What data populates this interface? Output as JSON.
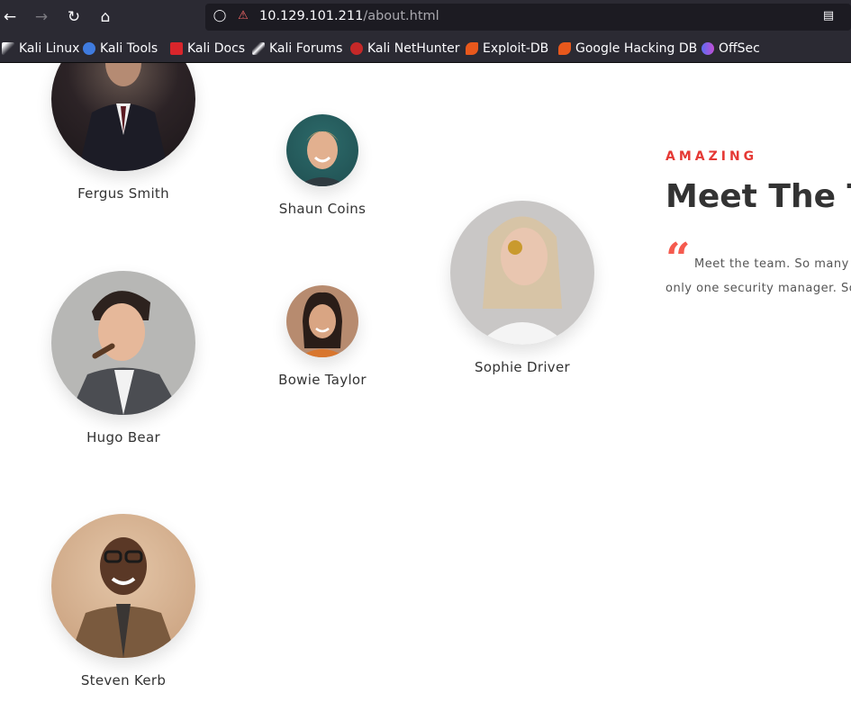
{
  "browser": {
    "url_host": "10.129.101.211",
    "url_path": "/about.html",
    "bookmarks": [
      {
        "label": "Kali Linux",
        "icon": "kali-dragon-icon"
      },
      {
        "label": "Kali Tools",
        "icon": "kali-tools-icon"
      },
      {
        "label": "Kali Docs",
        "icon": "kali-docs-icon"
      },
      {
        "label": "Kali Forums",
        "icon": "kali-forums-icon"
      },
      {
        "label": "Kali NetHunter",
        "icon": "kali-nethunter-icon"
      },
      {
        "label": "Exploit-DB",
        "icon": "exploit-db-icon"
      },
      {
        "label": "Google Hacking DB",
        "icon": "ghdb-icon"
      },
      {
        "label": "OffSec",
        "icon": "offsec-icon"
      }
    ]
  },
  "team": {
    "members": [
      {
        "name": "Fergus Smith"
      },
      {
        "name": "Shaun Coins"
      },
      {
        "name": "Sophie Driver"
      },
      {
        "name": "Hugo Bear"
      },
      {
        "name": "Bowie Taylor"
      },
      {
        "name": "Steven Kerb"
      }
    ],
    "kicker": "AMAZING",
    "heading": "Meet The Te",
    "paragraph_line1": "Meet the team. So many b",
    "paragraph_line2": "only one security manager. So"
  },
  "colors": {
    "accent": "#e53935",
    "browser_bg": "#2b2a33",
    "urlbar_bg": "#1c1b22"
  }
}
